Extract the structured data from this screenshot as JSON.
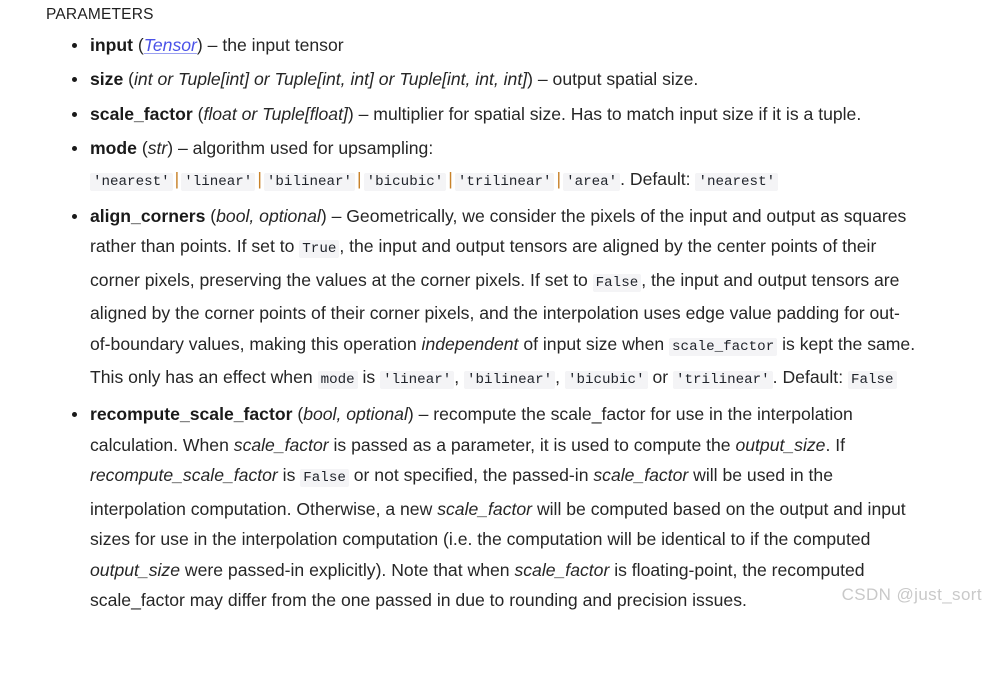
{
  "section": {
    "heading": "PARAMETERS"
  },
  "params": [
    {
      "name": "input",
      "type_text": "Tensor",
      "type_is_link": true,
      "desc_plain": "– the input tensor"
    },
    {
      "name": "size",
      "type_text": "int or Tuple[int] or Tuple[int, int] or Tuple[int, int, int]",
      "type_is_link": false,
      "desc_plain": "– output spatial size."
    },
    {
      "name": "scale_factor",
      "type_text": "float or Tuple[float]",
      "type_is_link": false,
      "desc_plain": "– multiplier for spatial size. Has to match input size if it is a tuple."
    },
    {
      "name": "mode",
      "type_text": "str",
      "type_is_link": false,
      "desc_lead": "– algorithm used for upsampling:",
      "modes": [
        "'nearest'",
        "'linear'",
        "'bilinear'",
        "'bicubic'",
        "'trilinear'",
        "'area'"
      ],
      "separator": "|",
      "default_label": ". Default:",
      "default_value": "'nearest'"
    },
    {
      "name": "align_corners",
      "type_text": "bool, optional",
      "type_is_link": false,
      "text_1": "– Geometrically, we consider the pixels of the input and output as squares rather than points. If set to",
      "code_true": "True",
      "text_2": ", the input and output tensors are aligned by the center points of their corner pixels, preserving the values at the corner pixels. If set to",
      "code_false": "False",
      "text_3": ", the input and output tensors are aligned by the corner points of their corner pixels, and the interpolation uses edge value padding for out-of-boundary values, making this operation",
      "em_independent": "independent",
      "text_4": "of input size when",
      "code_scale_factor": "scale_factor",
      "text_5": "is kept the same. This only has an effect when",
      "code_mode": "mode",
      "text_6": "is",
      "mode_values": [
        "'linear'",
        "'bilinear'",
        "'bicubic'",
        "'trilinear'"
      ],
      "mode_join_comma": ",",
      "mode_join_or": "or",
      "default_label": ". Default:",
      "default_value": "False"
    },
    {
      "name": "recompute_scale_factor",
      "type_text": "bool, optional",
      "type_is_link": false,
      "text_1": "– recompute the scale_factor for use in the interpolation calculation. When",
      "em_1": "scale_factor",
      "text_2": "is passed as a parameter, it is used to compute the",
      "em_2": "output_size",
      "text_3": ". If",
      "em_3": "recompute_scale_factor",
      "text_4": "is",
      "code_false": "False",
      "text_5": "or not specified, the passed-in",
      "em_4": "scale_factor",
      "text_6": "will be used in the interpolation computation. Otherwise, a new",
      "em_5": "scale_factor",
      "text_7": "will be computed based on the output and input sizes for use in the interpolation computation (i.e. the computation will be identical to if the computed",
      "em_6": "output_size",
      "text_8": "were passed-in explicitly). Note that when",
      "em_7": "scale_factor",
      "text_9": "is floating-point, the recomputed scale_factor may differ from the one passed in due to rounding and precision issues."
    }
  ],
  "watermark": {
    "text": "CSDN @just_sort"
  },
  "colors": {
    "link": "#4b52e8",
    "code_bg": "#f4f4f6",
    "pipe": "#c8822a",
    "text": "#262626",
    "watermark": "#c9c9c9"
  }
}
